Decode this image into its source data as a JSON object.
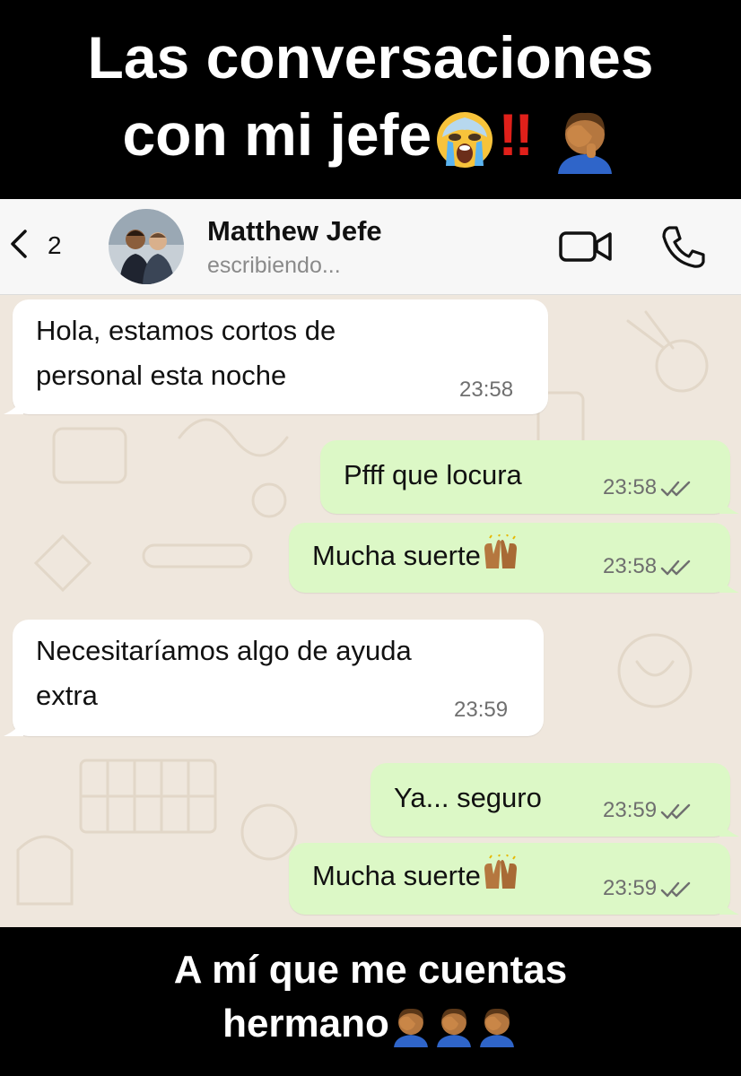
{
  "overlay": {
    "top_line1": "Las conversaciones",
    "top_line2": "con mi jefe",
    "top_bang": "!!",
    "bottom_line1": "A mí que me cuentas",
    "bottom_line2": "hermano"
  },
  "header": {
    "back_count": "2",
    "contact_name": "Matthew Jefe",
    "status": "escribiendo..."
  },
  "messages": [
    {
      "dir": "in",
      "line1": "Hola, estamos cortos de",
      "line2": "personal esta noche",
      "time": "23:58"
    },
    {
      "dir": "out",
      "line1": "Pfff que locura",
      "time": "23:58"
    },
    {
      "dir": "out",
      "line1": "Mucha suerte",
      "time": "23:58"
    },
    {
      "dir": "in",
      "line1": "Necesitaríamos algo de ayuda",
      "line2": "extra",
      "time": "23:59"
    },
    {
      "dir": "out",
      "line1": "Ya... seguro",
      "time": "23:59"
    },
    {
      "dir": "out",
      "line1": "Mucha suerte",
      "time": "23:59"
    }
  ],
  "colors": {
    "incoming_bubble": "#ffffff",
    "outgoing_bubble": "#dcf8c6",
    "wallpaper": "#efe7dd",
    "read_ticks": "#6f6f6f",
    "header_bg": "#f7f7f7"
  },
  "icons": [
    "back-chevron-icon",
    "video-call-icon",
    "phone-call-icon",
    "double-check-icon",
    "crying-face-emoji",
    "facepalm-emoji",
    "raised-hands-emoji"
  ]
}
